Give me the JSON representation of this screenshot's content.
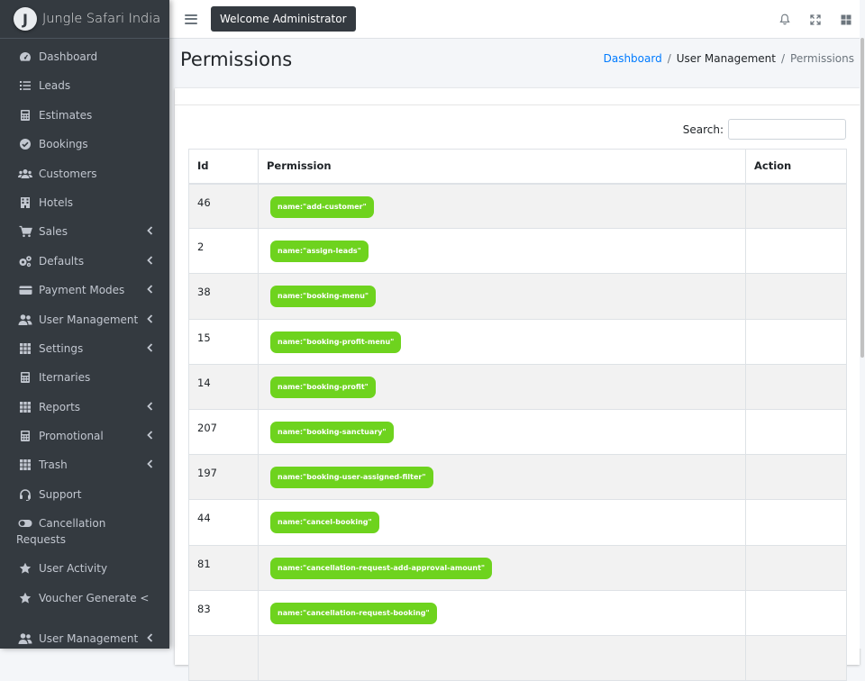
{
  "brand": {
    "logo_letter": "J",
    "name": "Jungle Safari India"
  },
  "header": {
    "welcome": "Welcome Administrator"
  },
  "sidebar": {
    "items": [
      {
        "label": "Dashboard",
        "icon": "dashboard-icon",
        "chevron": false
      },
      {
        "label": "Leads",
        "icon": "list-icon",
        "chevron": false
      },
      {
        "label": "Estimates",
        "icon": "calculator-icon",
        "chevron": false
      },
      {
        "label": "Bookings",
        "icon": "check-circle-icon",
        "chevron": false
      },
      {
        "label": "Customers",
        "icon": "users-icon",
        "chevron": false
      },
      {
        "label": "Hotels",
        "icon": "building-icon",
        "chevron": false
      },
      {
        "label": "Sales",
        "icon": "cart-icon",
        "chevron": true
      },
      {
        "label": "Defaults",
        "icon": "cogs-icon",
        "chevron": true
      },
      {
        "label": "Payment Modes",
        "icon": "wallet-icon",
        "chevron": true
      },
      {
        "label": "User Management",
        "icon": "user-group-icon",
        "chevron": true
      },
      {
        "label": "Settings",
        "icon": "grid-icon",
        "chevron": true
      },
      {
        "label": "Iternaries",
        "icon": "calculator-icon",
        "chevron": false
      },
      {
        "label": "Reports",
        "icon": "grid-icon",
        "chevron": true
      },
      {
        "label": "Promotional",
        "icon": "calculator-icon",
        "chevron": true
      },
      {
        "label": "Trash",
        "icon": "grid-icon",
        "chevron": true
      },
      {
        "label": "Support",
        "icon": "headset-icon",
        "chevron": false
      },
      {
        "label": "Cancellation",
        "label2": "Requests",
        "icon": "toggle-icon",
        "chevron": false
      },
      {
        "label": "User Activity",
        "icon": "star-icon",
        "chevron": false
      },
      {
        "label": "Voucher Generate <",
        "icon": "star-icon",
        "chevron": false
      },
      {
        "label": "User Management",
        "icon": "user-group-icon",
        "chevron": true
      }
    ]
  },
  "page": {
    "title": "Permissions",
    "breadcrumb": [
      "Dashboard",
      "User Management",
      "Permissions"
    ],
    "separator": "/"
  },
  "search": {
    "label": "Search:",
    "value": ""
  },
  "table": {
    "columns": [
      "Id",
      "Permission",
      "Action"
    ],
    "rows": [
      {
        "id": "46",
        "permission": "name:\"add-customer\""
      },
      {
        "id": "2",
        "permission": "name:\"assign-leads\""
      },
      {
        "id": "38",
        "permission": "name:\"booking-menu\""
      },
      {
        "id": "15",
        "permission": "name:\"booking-profit-menu\""
      },
      {
        "id": "14",
        "permission": "name:\"booking-profit\""
      },
      {
        "id": "207",
        "permission": "name:\"booking-sanctuary\""
      },
      {
        "id": "197",
        "permission": "name:\"booking-user-assigned-filter\""
      },
      {
        "id": "44",
        "permission": "name:\"cancel-booking\""
      },
      {
        "id": "81",
        "permission": "name:\"cancellation-request-add-approval-amount\""
      },
      {
        "id": "83",
        "permission": "name:\"cancellation-request-booking\""
      },
      {
        "id": "",
        "permission": ""
      }
    ]
  },
  "colors": {
    "sidebar_bg": "#343a40",
    "badge_green": "#6ed31e",
    "link_blue": "#007bff"
  }
}
